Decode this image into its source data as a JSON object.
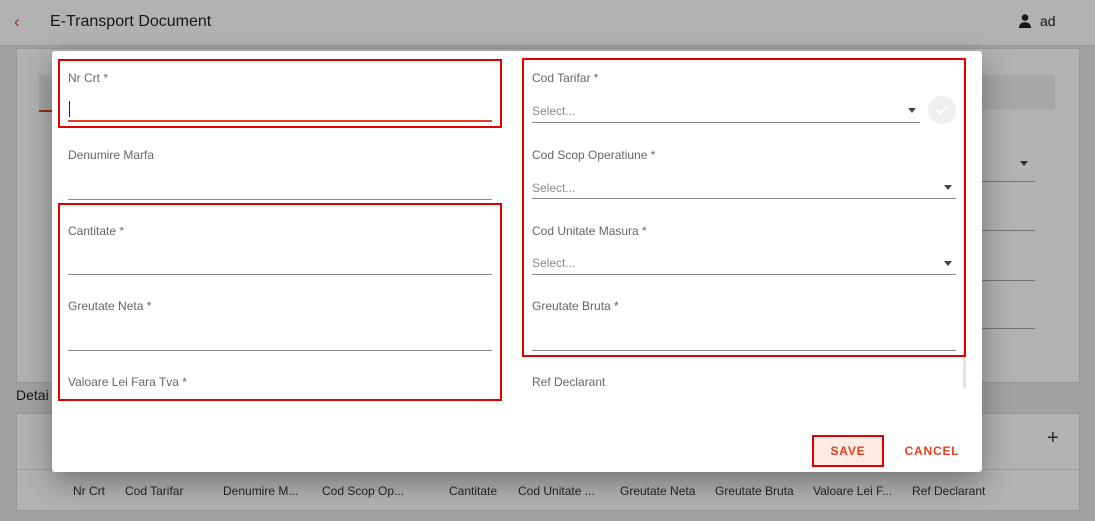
{
  "app": {
    "title": "E-Transport Document",
    "back_icon": "chevron-left-icon"
  },
  "user": {
    "name": "ad",
    "icon": "person-icon"
  },
  "page": {
    "details_label": "Detai"
  },
  "table": {
    "add_icon": "plus-icon",
    "headers": [
      "Nr Crt",
      "Cod Tarifar",
      "Denumire M...",
      "Cod Scop Op...",
      "Cantitate",
      "Cod Unitate ...",
      "Greutate Neta",
      "Greutate Bruta",
      "Valoare Lei F...",
      "Ref Declarant"
    ]
  },
  "form": {
    "nr_crt": {
      "label": "Nr Crt *",
      "value": ""
    },
    "denumire_marfa": {
      "label": "Denumire Marfa",
      "value": ""
    },
    "cantitate": {
      "label": "Cantitate *",
      "value": ""
    },
    "greutate_neta": {
      "label": "Greutate Neta *",
      "value": ""
    },
    "valoare_lei_fara_tva": {
      "label": "Valoare Lei Fara Tva *"
    },
    "cod_tarifar": {
      "label": "Cod Tarifar *",
      "placeholder": "Select..."
    },
    "cod_scop_operatiune": {
      "label": "Cod Scop Operatiune *",
      "placeholder": "Select..."
    },
    "cod_unitate_masura": {
      "label": "Cod Unitate Masura *",
      "placeholder": "Select..."
    },
    "greutate_bruta": {
      "label": "Greutate Bruta *",
      "value": ""
    },
    "ref_declarant": {
      "label": "Ref Declarant"
    }
  },
  "actions": {
    "save_label": "SAVE",
    "cancel_label": "CANCEL"
  },
  "colors": {
    "accent": "#e0401c",
    "highlight": "#e00000"
  }
}
